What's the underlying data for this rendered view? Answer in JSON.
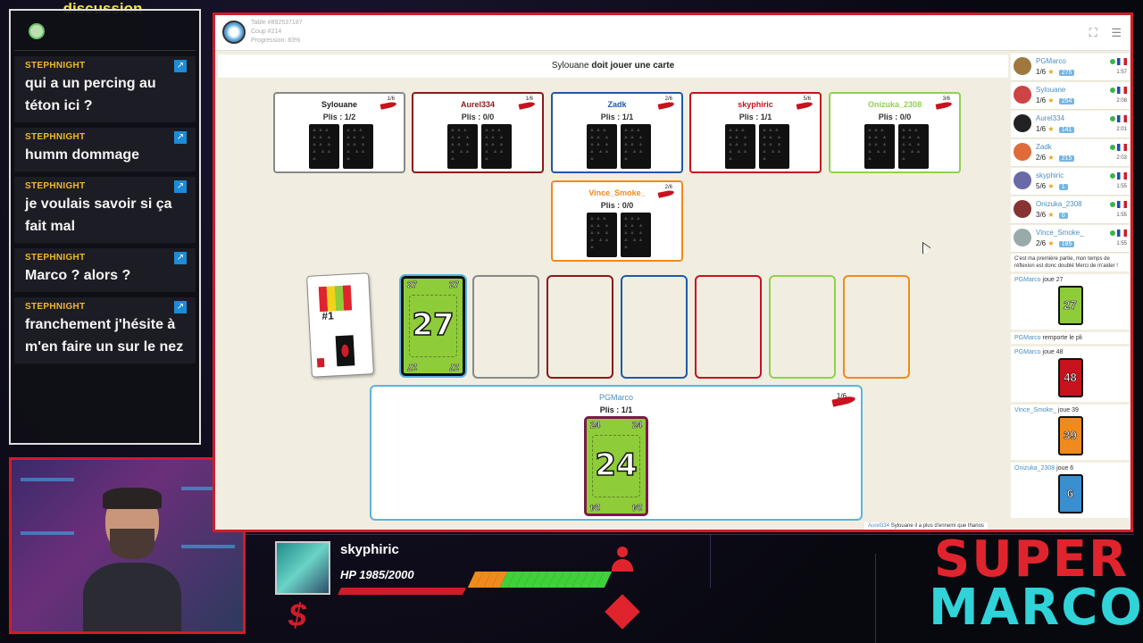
{
  "chat": {
    "title": "discussion",
    "messages": [
      {
        "user": "STEPHNIGHT",
        "text": "qui a un percing au téton ici ?"
      },
      {
        "user": "STEPHNIGHT",
        "text": "humm dommage"
      },
      {
        "user": "STEPHNIGHT",
        "text": "je voulais savoir si ça fait mal"
      },
      {
        "user": "STEPHNIGHT",
        "text": "Marco ? alors ?"
      },
      {
        "user": "STEPHNIGHT",
        "text": "franchement j'hésite à m'en faire un sur le nez"
      }
    ]
  },
  "hud": {
    "player_name": "skyphiric",
    "hp_text": "HP 1985/2000",
    "hp_fraction": 0.9925,
    "currency_symbol": "$",
    "colors": {
      "accent": "#d01c2a",
      "hp_green": "#3fd03a",
      "hp_orange": "#f08a1c"
    }
  },
  "logo": {
    "line1": "SUPER",
    "line2": "MARCO"
  },
  "game": {
    "meta_table": "Table #892537187",
    "meta_move": "Coup #214",
    "meta_progress": "Progression: 83%",
    "status_player": "Sylouane",
    "status_action": "doit jouer une carte",
    "opponents": [
      {
        "name": "Sylouane",
        "tricks": "Plis : 1/2",
        "bid": "1/6",
        "color": "#888888"
      },
      {
        "name": "Aurel334",
        "tricks": "Plis : 0/0",
        "bid": "1/6",
        "color": "#8a1a1a"
      },
      {
        "name": "Zadk",
        "tricks": "Plis : 1/1",
        "bid": "2/6",
        "color": "#1f5aa8"
      },
      {
        "name": "skyphiric",
        "tricks": "Plis : 1/1",
        "bid": "5/6",
        "color": "#c8121e"
      },
      {
        "name": "Onizuka_2308",
        "tricks": "Plis : 0/0",
        "bid": "3/6",
        "color": "#8fd14f"
      },
      {
        "name": "Vince_Smoke_",
        "tricks": "Plis : 0/0",
        "bid": "2/6",
        "color": "#f08a1c"
      }
    ],
    "pile_label": "#1",
    "played_card": {
      "value": "27",
      "color": "#8fcc3a"
    },
    "slot_colors": [
      "#888888",
      "#8a1a1a",
      "#1f5aa8",
      "#c8121e",
      "#8fd14f",
      "#f08a1c"
    ],
    "me": {
      "name": "PGMarco",
      "tricks": "Plis : 1/1",
      "bid": "1/6",
      "hand": [
        {
          "value": "24",
          "color": "#8fcc3a"
        }
      ]
    },
    "chat_line_user": "Aurel334",
    "chat_line_text": "Sylouane il a plus d'ennemi que thanos"
  },
  "side": {
    "players": [
      {
        "name": "PGMarco",
        "score": "1/6",
        "rank": "275",
        "time": "1:57",
        "avatar": "#a0783e"
      },
      {
        "name": "Sylouane",
        "score": "1/6",
        "rank": "254",
        "time": "2:08",
        "avatar": "#c44"
      },
      {
        "name": "Aurel334",
        "score": "1/6",
        "rank": "141",
        "time": "2:01",
        "avatar": "#222"
      },
      {
        "name": "Zadk",
        "score": "2/6",
        "rank": "215",
        "time": "2:03",
        "avatar": "#e06a3a"
      },
      {
        "name": "skyphiric",
        "score": "5/6",
        "rank": "1",
        "time": "1:55",
        "avatar": "#6a6aa8"
      },
      {
        "name": "Onizuka_2308",
        "score": "3/6",
        "rank": "0",
        "time": "1:55",
        "avatar": "#883333"
      },
      {
        "name": "Vince_Smoke_",
        "score": "2/6",
        "rank": "185",
        "time": "1:55",
        "avatar": "#9aa"
      }
    ],
    "note": "C'est ma première partie, mon temps de réflexion est donc doublé Merci de m'aider !",
    "log": [
      {
        "user": "PGMarco",
        "text": "joue 27",
        "card": "27",
        "color": "#8fcc3a"
      },
      {
        "user": "PGMarco",
        "text": "remporte le pli",
        "card": "",
        "color": ""
      },
      {
        "user": "PGMarco",
        "text": "joue 48",
        "card": "48",
        "color": "#c8121e"
      },
      {
        "user": "Vince_Smoke_",
        "text": "joue 39",
        "card": "39",
        "color": "#f08a1c"
      },
      {
        "user": "Onizuka_2308",
        "text": "joue 6",
        "card": "6",
        "color": "#3a8fd1"
      }
    ]
  }
}
